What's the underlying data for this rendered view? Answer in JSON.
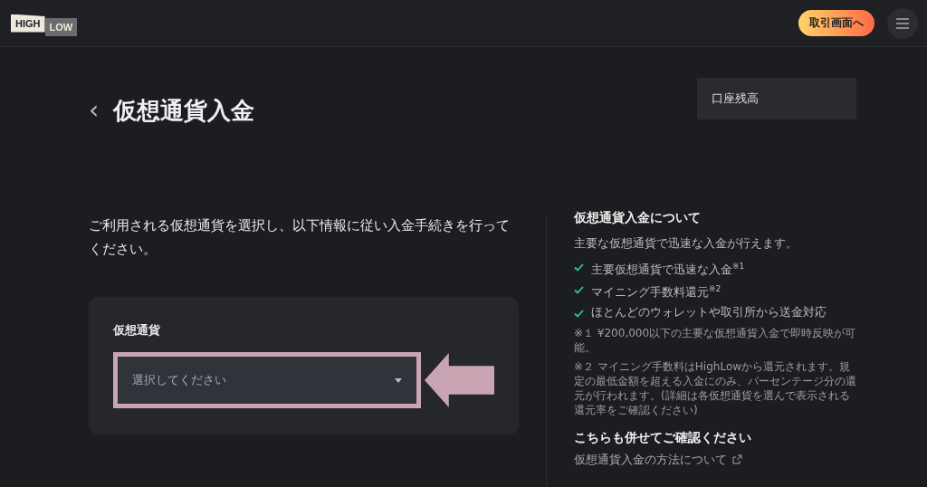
{
  "header": {
    "logo": {
      "high": "HIGH",
      "low": "LOW"
    },
    "trade_button": "取引画面へ"
  },
  "page": {
    "back": "‹",
    "title": "仮想通貨入金",
    "balance_label": "口座残高"
  },
  "intro": "ご利用される仮想通貨を選択し、以下情報に従い入金手続きを行ってください。",
  "form": {
    "label": "仮想通貨",
    "select": {
      "placeholder": "選択してください",
      "highlighted": true
    }
  },
  "about": {
    "heading": "仮想通貨入金について",
    "lead": "主要な仮想通貨で迅速な入金が行えます。",
    "features": [
      "主要仮想通貨で迅速な入金$^{※1}$",
      "マイニング手数料還元$^{※2}$",
      "ほとんどのウォレットや取引所から送金対応"
    ],
    "notes": [
      "※１ ¥200,000以下の主要な仮想通貨入金で即時反映が可能。",
      "※２ マイニング手数料はHighLowから還元されます。規定の最低金額を超える入金にのみ、パーセンテージ分の還元が行われます。(詳細は各仮想通貨を選んで表示される還元率をご確認ください)"
    ]
  },
  "see_also": {
    "heading": "こちらも併せてご確認ください",
    "links": [
      "仮想通貨入金の方法について"
    ]
  }
}
